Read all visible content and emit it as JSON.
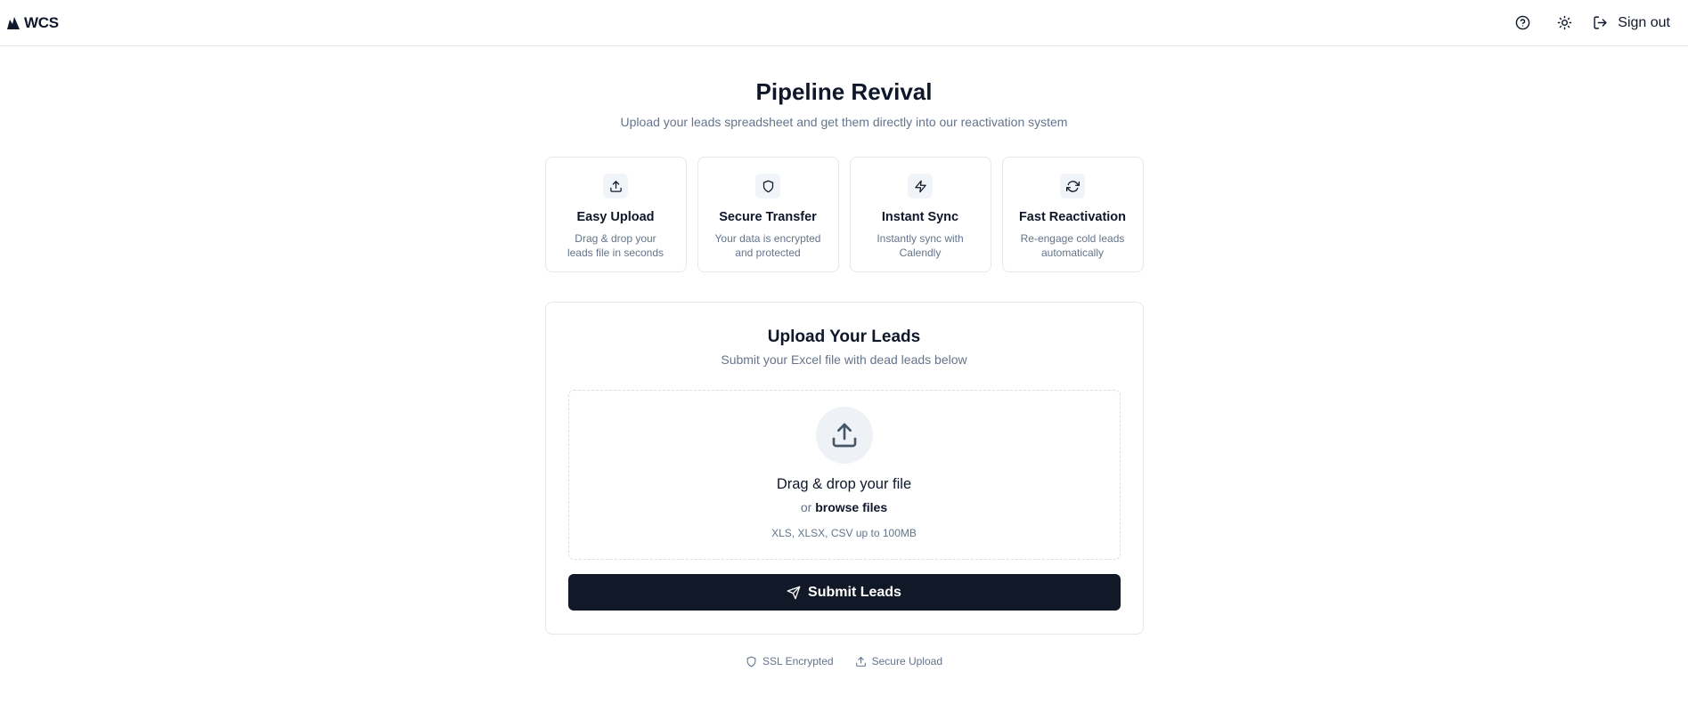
{
  "header": {
    "brand": "WCS",
    "help_icon": "help-circle-icon",
    "theme_icon": "sun-icon",
    "signout_icon": "log-out-icon",
    "signout_label": "Sign out"
  },
  "hero": {
    "title": "Pipeline Revival",
    "subtitle": "Upload your leads spreadsheet and get them directly into our reactivation system"
  },
  "features": [
    {
      "icon": "upload-icon",
      "title": "Easy Upload",
      "desc": "Drag & drop your leads file in seconds"
    },
    {
      "icon": "shield-icon",
      "title": "Secure Transfer",
      "desc": "Your data is encrypted and protected"
    },
    {
      "icon": "zap-icon",
      "title": "Instant Sync",
      "desc": "Instantly sync with Calendly"
    },
    {
      "icon": "refresh-icon",
      "title": "Fast Reactivation",
      "desc": "Re-engage cold leads automatically"
    }
  ],
  "upload": {
    "title": "Upload Your Leads",
    "subtitle": "Submit your Excel file with dead leads below",
    "drop_title": "Drag & drop your file",
    "or_text": "or",
    "browse_label": "browse files",
    "hint": "XLS, XLSX, CSV up to 100MB",
    "submit_label": "Submit Leads"
  },
  "trust": [
    {
      "icon": "shield-icon",
      "label": "SSL Encrypted"
    },
    {
      "icon": "upload-icon",
      "label": "Secure Upload"
    }
  ],
  "colors": {
    "primary": "#111827",
    "muted_text": "#64748b",
    "border": "#e5e7eb",
    "icon_bg": "#f1f5f9"
  }
}
